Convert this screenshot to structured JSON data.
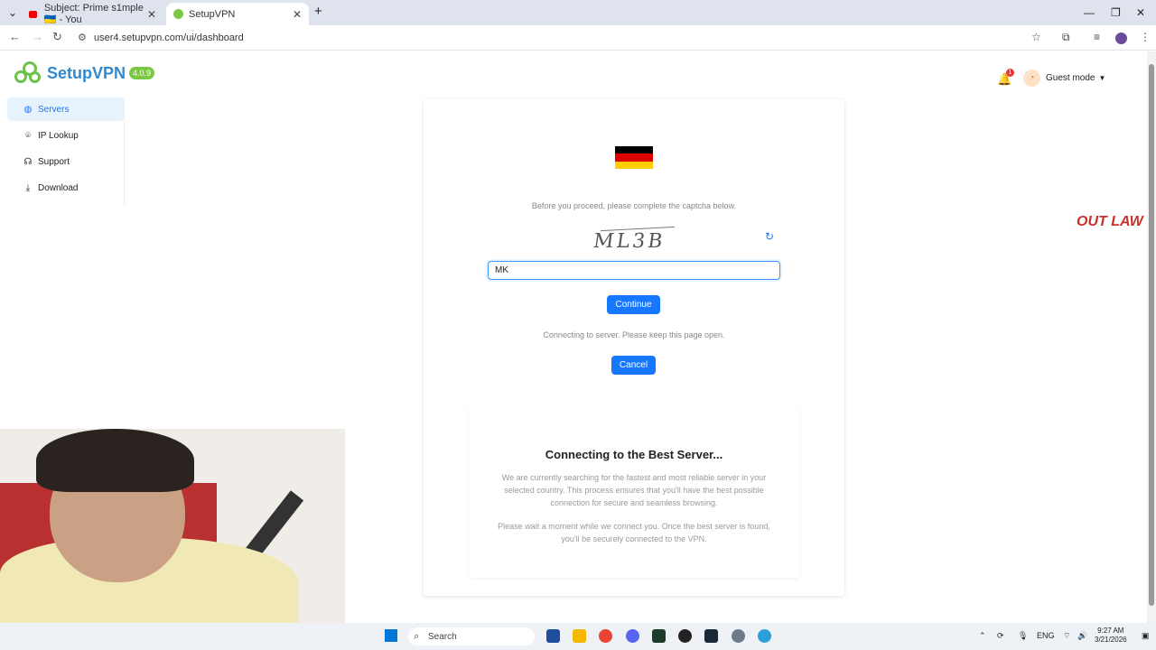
{
  "browser": {
    "tabs": [
      {
        "title": "Subject: Prime s1mple 🇺🇦 - You"
      },
      {
        "title": "SetupVPN"
      }
    ],
    "url": "user4.setupvpn.com/ui/dashboard"
  },
  "app": {
    "brand": "SetupVPN",
    "version": "4.0.9"
  },
  "sidebar": {
    "items": [
      {
        "label": "Servers",
        "icon": "globe-icon",
        "active": true
      },
      {
        "label": "IP Lookup",
        "icon": "location-pin-icon"
      },
      {
        "label": "Support",
        "icon": "headset-icon"
      },
      {
        "label": "Download",
        "icon": "download-icon"
      }
    ]
  },
  "header": {
    "notification_count": "1",
    "user_label": "Guest mode"
  },
  "captcha": {
    "flag_colors": [
      "#000000",
      "#dd0000",
      "#ffce00"
    ],
    "prompt": "Before you proceed, please complete the captcha below.",
    "image_text": "ML3B",
    "input_value": "MK",
    "continue_label": "Continue"
  },
  "connecting": {
    "status": "Connecting to server. Please keep this page open.",
    "cancel_label": "Cancel",
    "title": "Connecting to the Best Server...",
    "paragraph1": "We are currently searching for the fastest and most reliable server in your selected country. This process ensures that you'll have the best possible connection for secure and seamless browsing.",
    "paragraph2": "Please wait a moment while we connect you. Once the best server is found, you'll be securely connected to the VPN."
  },
  "overlay": {
    "logo_text": "OUT LAW"
  },
  "taskbar": {
    "search_label": "Search",
    "language": "ENG",
    "time": "9:27 AM",
    "date": "3/21/2026"
  }
}
